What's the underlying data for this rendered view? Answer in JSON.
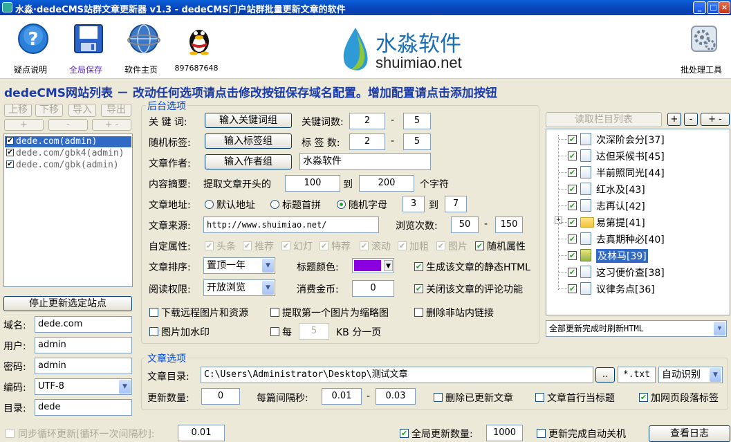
{
  "window": {
    "title": "水淼·dedeCMS站群文章更新器 v1.3 - dedeCMS门户站群批量更新文章的软件",
    "btn_min": "_",
    "btn_max": "□",
    "btn_close": "×"
  },
  "toolbar": {
    "help": "疑点说明",
    "save": "全局保存",
    "home": "软件主页",
    "qq": "897687648",
    "batch": "批处理工具",
    "help_glyph": "?",
    "brand_cn": "水淼软件",
    "brand_en": "shuimiao.net"
  },
  "heading": "dedeCMS网站列表 － 改动任何选项请点击修改按钮保存域名配置。增加配置请点击添加按钮",
  "left": {
    "btn_up": "上移",
    "btn_down": "下移",
    "btn_import": "导入",
    "btn_export": "导出",
    "btn_add": "+",
    "btn_minus": "-",
    "btn_plusminus": "+ -",
    "sites": [
      "dede.com(admin)",
      "dede.com/gbk4(admin)",
      "dede.com/gbk(admin)"
    ],
    "stop_btn": "停止更新选定站点",
    "domain_label": "域名:",
    "domain": "dede.com",
    "user_label": "用户:",
    "user": "admin",
    "pass_label": "密码:",
    "pass": "admin",
    "enc_label": "编码:",
    "enc": "UTF-8",
    "dir_label": "目录:",
    "dir": "dede"
  },
  "backend": {
    "title": "后台选项",
    "keyword_label": "关 键 词:",
    "keyword_btn": "输入关键词组",
    "keyword_count_label": "关键词数:",
    "keyword_min": "2",
    "keyword_max": "5",
    "tag_label": "随机标签:",
    "tag_btn": "输入标签组",
    "tag_count_label": "标 签 数:",
    "tag_min": "2",
    "tag_max": "5",
    "author_label": "文章作者:",
    "author_btn": "输入作者组",
    "author": "水淼软件",
    "summary_label": "内容摘要:",
    "summary_text": "提取文章开头的",
    "summary_min": "100",
    "summary_to": "到",
    "summary_max": "200",
    "summary_unit": "个字符",
    "url_label": "文章地址:",
    "url_opt1": "默认地址",
    "url_opt2": "标题首拼",
    "url_opt3": "随机字母",
    "url_min": "3",
    "url_to": "到",
    "url_max": "7",
    "source_label": "文章来源:",
    "source": "http://www.shuimiao.net/",
    "views_label": "浏览次数:",
    "views_min": "50",
    "views_max": "150",
    "attr_label": "自定属性:",
    "attrs": [
      "头条",
      "推荐",
      "幻灯",
      "特荐",
      "滚动",
      "加粗",
      "图片"
    ],
    "attr_random": "随机属性",
    "sort_label": "文章排序:",
    "sort": "置顶一年",
    "color_label": "标题颜色:",
    "color_value": "#8a00e0",
    "static_html": "生成该文章的静态HTML",
    "read_label": "阅读权限:",
    "read": "开放浏览",
    "gold_label": "消费金币:",
    "gold": "0",
    "close_comment": "关闭该文章的评论功能",
    "dl_remote": "下载远程图片和资源",
    "first_img": "提取第一个图片为缩略图",
    "del_links": "删除非站内链接",
    "watermark": "图片加水印",
    "per_label": "每",
    "per_val": "5",
    "per_unit": "KB 分一页"
  },
  "column": {
    "read_btn": "读取栏目列表",
    "btn_plus": "+",
    "btn_minus": "-",
    "btn_pm1": "+",
    "btn_pm2": "-",
    "expander": "+",
    "items": [
      "次深阶会分[37]",
      "达但采候书[45]",
      "半前照同光[44]",
      "红水及[43]",
      "志再认[42]",
      "易第提[41]",
      "去真期种必[40]",
      "及林马[39]",
      "这习便价查[38]",
      "议律务点[36]"
    ],
    "refresh": "全部更新完成时刷新HTML"
  },
  "article": {
    "title": "文章选项",
    "dir_label": "文章目录:",
    "dir": "C:\\Users\\Administrator\\Desktop\\测试文章",
    "browse_btn": "..",
    "ext": "*.txt",
    "enc": "自动识别",
    "count_label": "更新数量:",
    "count": "0",
    "interval_label": "每篇间隔秒:",
    "interval_min": "0.01",
    "interval_max": "0.03",
    "del_updated": "删除已更新文章",
    "first_line_title": "文章首行当标题",
    "add_para_tag": "加网页段落标签"
  },
  "bottom": {
    "sync_label": "同步循环更新[循环一次间隔秒]:",
    "sync_val": "0.01",
    "global_count_label": "全局更新数量:",
    "global_count": "1000",
    "shutdown": "更新完成自动关机",
    "log_btn": "查看日志"
  }
}
